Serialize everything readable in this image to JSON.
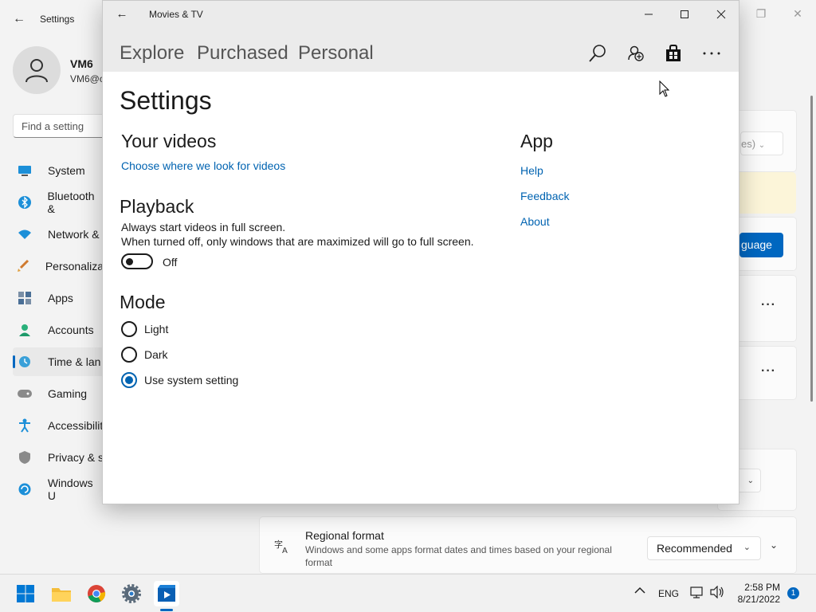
{
  "bg_settings": {
    "title": "Settings",
    "user_name": "VM6",
    "user_email": "VM6@c",
    "search_placeholder": "Find a setting",
    "nav_items": [
      {
        "label": "System",
        "icon": "monitor-icon"
      },
      {
        "label": "Bluetooth &",
        "icon": "bluetooth-icon"
      },
      {
        "label": "Network &",
        "icon": "wifi-icon"
      },
      {
        "label": "Personaliza",
        "icon": "brush-icon"
      },
      {
        "label": "Apps",
        "icon": "apps-icon"
      },
      {
        "label": "Accounts",
        "icon": "person-icon"
      },
      {
        "label": "Time & lan",
        "icon": "clock-globe-icon"
      },
      {
        "label": "Gaming",
        "icon": "gamepad-icon"
      },
      {
        "label": "Accessibilit",
        "icon": "accessibility-icon"
      },
      {
        "label": "Privacy & s",
        "icon": "shield-icon"
      },
      {
        "label": "Windows U",
        "icon": "refresh-icon"
      }
    ],
    "partial_select_text": "es)",
    "language_button_label": "guage",
    "regional_format": {
      "title": "Regional format",
      "description": "Windows and some apps format dates and times based on your regional format",
      "value": "Recommended"
    }
  },
  "movies_tv": {
    "window_title": "Movies & TV",
    "tabs": [
      "Explore",
      "Purchased",
      "Personal"
    ],
    "toolbar": [
      "search-icon",
      "account-add-icon",
      "store-icon",
      "more-icon"
    ],
    "page_title": "Settings",
    "your_videos": {
      "heading": "Your videos",
      "link": "Choose where we look for videos"
    },
    "playback": {
      "heading": "Playback",
      "line1": "Always start videos in full screen.",
      "line2": "When turned off, only windows that are maximized will go to full screen.",
      "toggle_label": "Off",
      "toggle_on": false
    },
    "mode": {
      "heading": "Mode",
      "options": [
        "Light",
        "Dark",
        "Use system setting"
      ],
      "selected": "Use system setting"
    },
    "app": {
      "heading": "App",
      "links": [
        "Help",
        "Feedback",
        "About"
      ]
    }
  },
  "taskbar": {
    "tray": {
      "language": "ENG",
      "time": "2:58 PM",
      "date": "8/21/2022",
      "notification_count": "1"
    },
    "accent": "#0067c0"
  }
}
